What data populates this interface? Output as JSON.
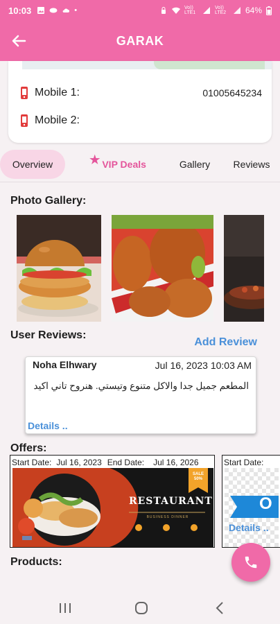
{
  "status_bar": {
    "time": "10:03",
    "network_labels": [
      "Vo)) LTE1",
      "Vo)) LTE2"
    ],
    "battery": "64%",
    "icons": [
      "gallery-icon",
      "game-icon",
      "cloud-icon",
      "dot-icon",
      "lock-icon",
      "wifi-icon",
      "signal-icon",
      "battery-icon"
    ]
  },
  "app_bar": {
    "title": "GARAK",
    "back_icon": "arrow-left-icon"
  },
  "contact": {
    "rows": [
      {
        "label": "Mobile 1:",
        "value": "01005645234"
      },
      {
        "label": "Mobile 2:",
        "value": ""
      }
    ]
  },
  "tabs": [
    {
      "label": "Overview",
      "active": true
    },
    {
      "label": "VIP Deals",
      "active": false,
      "icon": "star-icon"
    },
    {
      "label": "Gallery",
      "active": false
    },
    {
      "label": "Reviews",
      "active": false
    }
  ],
  "gallery": {
    "title": "Photo Gallery:",
    "images": [
      "burger-photo",
      "fried-chicken-photo",
      "grill-photo"
    ]
  },
  "reviews": {
    "title": "User Reviews:",
    "add_label": "Add Review",
    "items": [
      {
        "author": "Noha Elhwary",
        "date": "Jul 16, 2023 10:03 AM",
        "text": "المطعم جميل جدا والاكل متنوع وتيستي. هنروح تاني اكيد",
        "details_label": "Details .."
      }
    ]
  },
  "offers": {
    "title": "Offers:",
    "items": [
      {
        "start_label": "Start Date:",
        "start_date": "Jul 16, 2023",
        "end_label": "End Date:",
        "end_date": "Jul 16, 2026",
        "banner_title": "RESTAURANT",
        "banner_subtitle": "BUSINESS DINNER",
        "sale_badge_line1": "SALE",
        "sale_badge_line2": "50%",
        "details_label": "Details .."
      },
      {
        "start_label": "Start Date:",
        "details_label": "Details ..",
        "banner_letter": "O"
      }
    ]
  },
  "products": {
    "title": "Products:"
  },
  "fab": {
    "icon": "phone-icon"
  },
  "nav_bar": {
    "icons": [
      "recents-icon",
      "home-icon",
      "back-icon"
    ]
  },
  "colors": {
    "primary": "#f06aa8",
    "tab_active_bg": "#f8d6e6",
    "vip": "#e4559b",
    "link": "#4a90d9"
  }
}
